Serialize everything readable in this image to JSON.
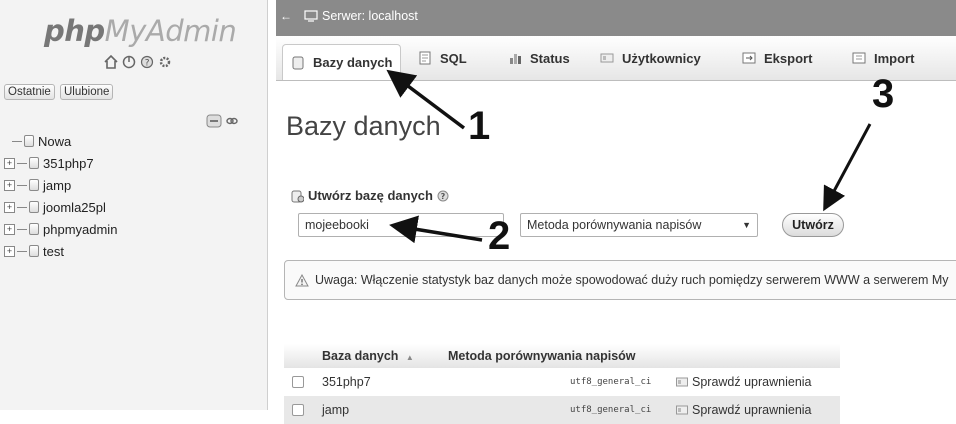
{
  "sidebar": {
    "logo_php": "php",
    "logo_rest": "MyAdmin",
    "icons": [
      "home-icon",
      "exit-icon",
      "docs-icon",
      "settings-icon"
    ],
    "recent_label": "Ostatnie",
    "favorites_label": "Ulubione",
    "tree": [
      {
        "label": "Nowa"
      },
      {
        "label": "351php7"
      },
      {
        "label": "jamp"
      },
      {
        "label": "joomla25pl"
      },
      {
        "label": "phpmyadmin"
      },
      {
        "label": "test"
      }
    ]
  },
  "topbar": {
    "server_label": "Serwer: localhost"
  },
  "tabs": [
    {
      "label": "Bazy danych",
      "icon": "database-icon",
      "active": true
    },
    {
      "label": "SQL",
      "icon": "sql-icon"
    },
    {
      "label": "Status",
      "icon": "status-icon"
    },
    {
      "label": "Użytkownicy",
      "icon": "users-icon"
    },
    {
      "label": "Eksport",
      "icon": "export-icon"
    },
    {
      "label": "Import",
      "icon": "import-icon"
    }
  ],
  "main": {
    "title": "Bazy danych",
    "create_label": "Utwórz bazę danych",
    "db_name_value": "mojeebooki",
    "collation_selected": "Metoda porównywania napisów",
    "create_button": "Utwórz",
    "warning_text": "Uwaga: Włączenie statystyk baz danych może spowodować duży ruch pomiędzy serwerem WWW a serwerem My"
  },
  "table": {
    "headers": [
      "Baza danych",
      "Metoda porównywania napisów"
    ],
    "sort_indicator": "▲",
    "rows": [
      {
        "name": "351php7",
        "collation": "utf8_general_ci",
        "action": "Sprawdź uprawnienia"
      },
      {
        "name": "jamp",
        "collation": "utf8_general_ci",
        "action": "Sprawdź uprawnienia"
      }
    ]
  },
  "annotations": {
    "one": "1",
    "two": "2",
    "three": "3"
  },
  "colors": {
    "topbar": "#8a8a8a",
    "sidebar": "#f3f3f3",
    "text": "#222222"
  }
}
